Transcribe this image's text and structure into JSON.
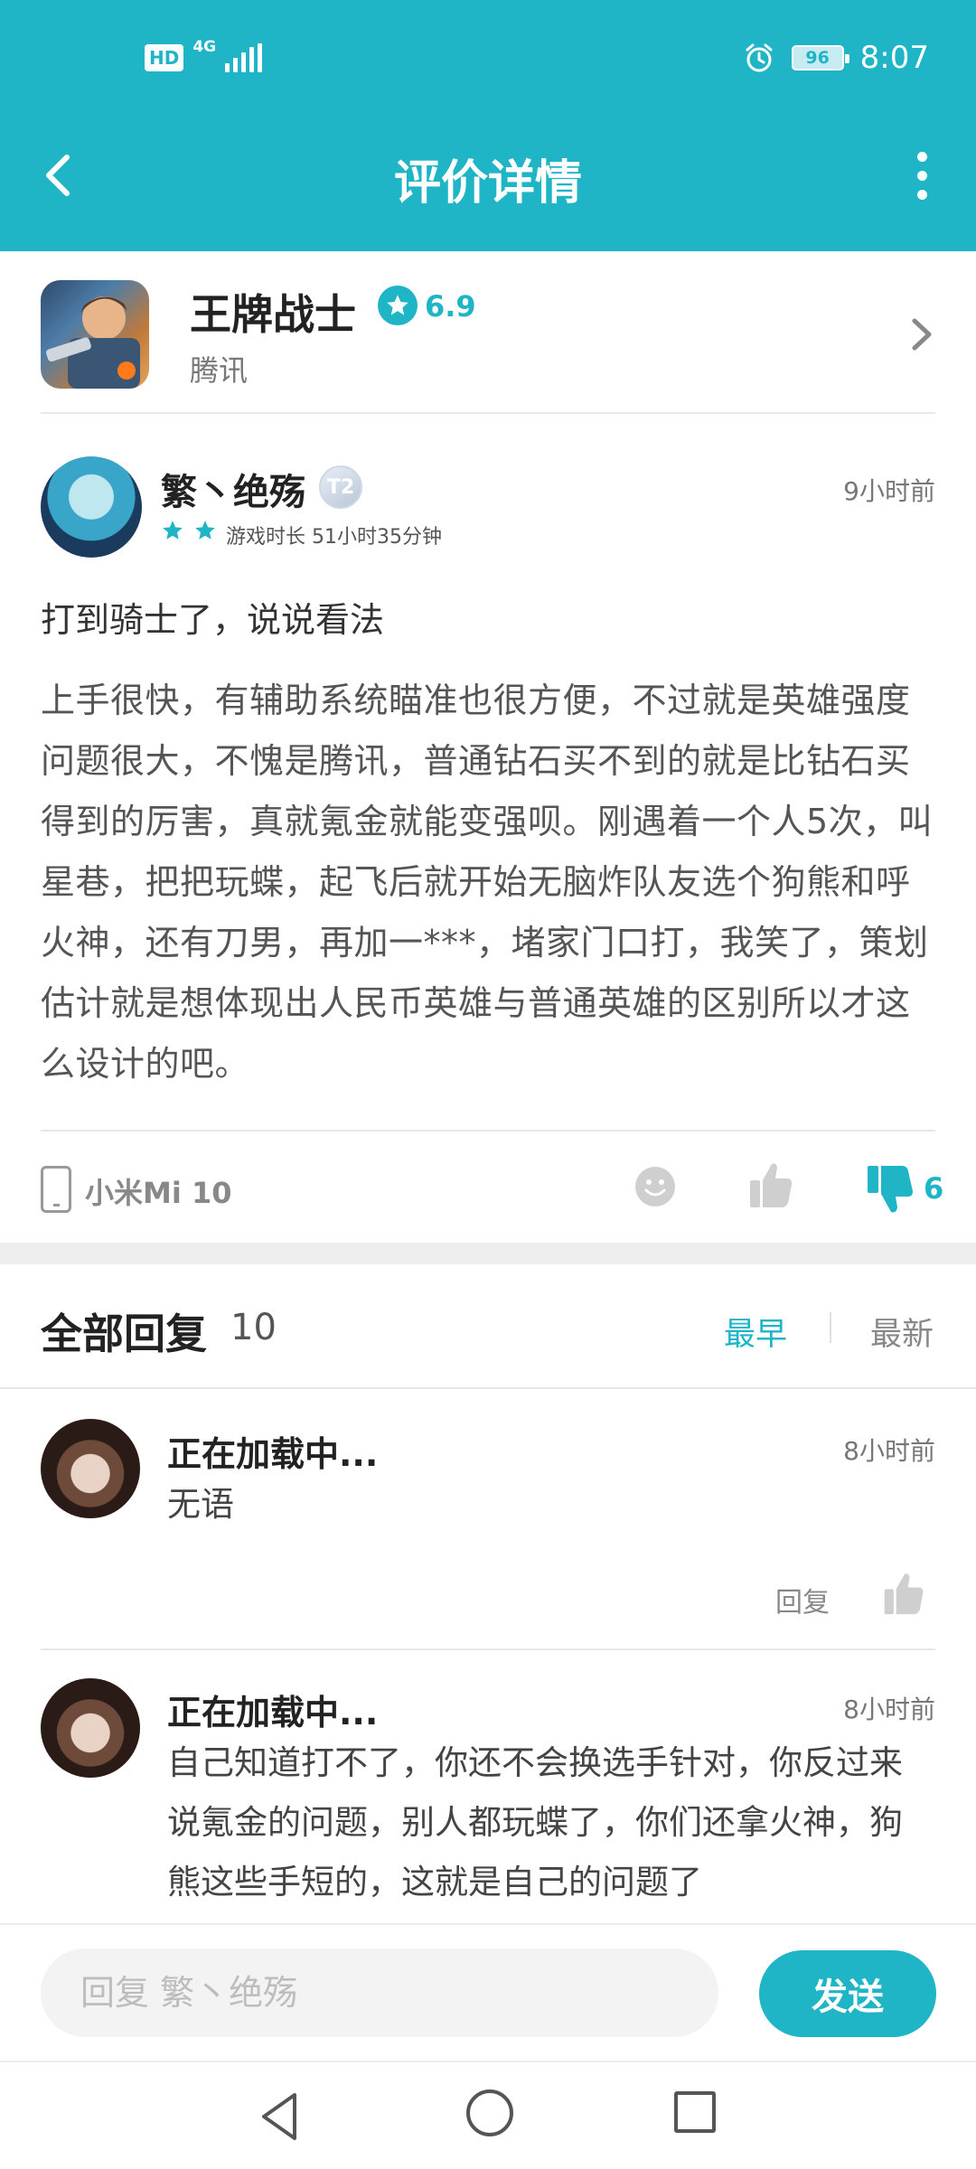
{
  "status_bar": {
    "hd": "HD",
    "network": "4G",
    "battery": "96",
    "time": "8:07"
  },
  "header": {
    "title": "评价详情"
  },
  "game": {
    "name": "王牌战士",
    "rating": "6.9",
    "publisher": "腾讯"
  },
  "review": {
    "author": "繁丶绝殇",
    "level_badge": "T2",
    "time_ago": "9小时前",
    "star_count": 2,
    "playtime": "游戏时长 51小时35分钟",
    "title": "打到骑士了，说说看法",
    "body": "上手很快，有辅助系统瞄准也很方便，不过就是英雄强度问题很大，不愧是腾讯，普通钻石买不到的就是比钻石买得到的厉害，真就氪金就能变强呗。刚遇着一个人5次，叫星巷，把把玩蝶，起飞后就开始无脑炸队友选个狗熊和呼火神，还有刀男，再加一***，堵家门口打，我笑了，策划估计就是想体现出人民币英雄与普通英雄的区别所以才这么设计的吧。",
    "device": "小米Mi 10",
    "dislike_count": "6"
  },
  "replies_section": {
    "title": "全部回复",
    "count": "10",
    "sort_earliest": "最早",
    "sort_latest": "最新"
  },
  "replies": [
    {
      "author": "正在加载中...",
      "time_ago": "8小时前",
      "text": "无语",
      "reply_label": "回复"
    },
    {
      "author": "正在加载中...",
      "time_ago": "8小时前",
      "text": "自己知道打不了，你还不会换选手针对，你反过来说氪金的问题，别人都玩蝶了，你们还拿火神，狗熊这些手短的，这就是自己的问题了"
    }
  ],
  "input_bar": {
    "placeholder": "回复 繁丶绝殇",
    "send_label": "发送"
  },
  "colors": {
    "accent": "#1fb5c6",
    "text_primary": "#222222",
    "text_secondary": "#777777"
  },
  "icons": {
    "back": "chevron-left-icon",
    "more": "more-vertical-icon",
    "chevron": "chevron-right-icon",
    "device": "phone-icon",
    "emoji": "smiley-icon",
    "like": "thumbs-up-icon",
    "dislike": "thumbs-down-icon"
  }
}
